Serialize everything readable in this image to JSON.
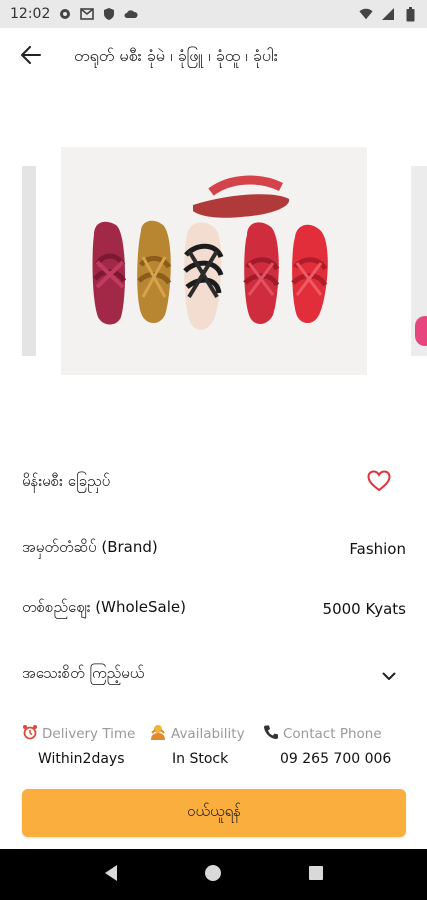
{
  "status_bar": {
    "time": "12:02",
    "icons": [
      "gear-icon",
      "gmail-icon",
      "shield-icon",
      "cloud-icon",
      "wifi-icon",
      "signal-icon",
      "battery-icon"
    ]
  },
  "app_bar": {
    "back_icon": "arrow-left-icon",
    "title": "တရုတ် မစီး ခုံမဲ ၊ ခုံဖြူ ၊ ခုံထူ ၊ ခုံပါး"
  },
  "product": {
    "name": "မိန်းမစီး ခြေညှပ်",
    "brand_label": "အမှတ်တံဆိပ် (Brand)",
    "brand_value": "Fashion",
    "price_label": "တစ်စည်ဈေး (WholeSale)",
    "price_value": "5000 Kyats",
    "details_label": "အသေးစိတ် ကြည့်မယ်"
  },
  "info": {
    "delivery_label": "Delivery Time",
    "delivery_value": "Within2days",
    "availability_label": "Availability",
    "availability_value": "In Stock",
    "contact_label": "Contact Phone",
    "contact_value": "09 265 700 006"
  },
  "order_button": "ဝယ်ယူရန်",
  "colors": {
    "accent": "#f9ae3d",
    "heart": "#e0323a",
    "muted": "#9a9a9a",
    "status_bar_bg": "#e9e9e9",
    "nav_bar_bg": "#000000"
  }
}
